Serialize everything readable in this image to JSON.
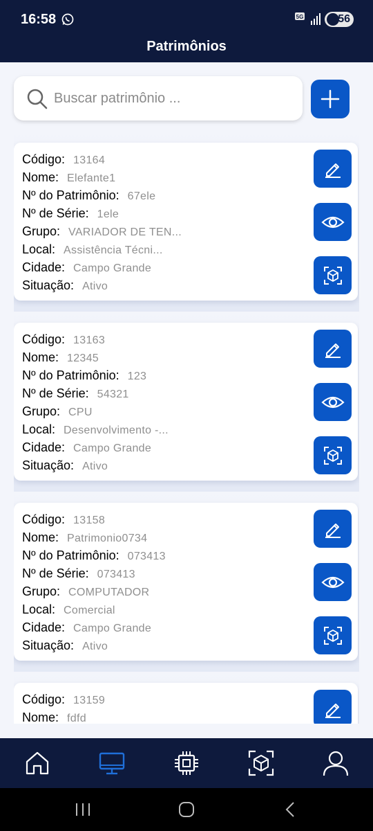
{
  "status_bar": {
    "time": "16:58",
    "network": "5G",
    "battery": "56"
  },
  "header": {
    "title": "Patrimônios"
  },
  "search": {
    "placeholder": "Buscar patrimônio ..."
  },
  "labels": {
    "codigo": "Código:",
    "nome": "Nome:",
    "patrimonio": "Nº do Patrimônio:",
    "serie": "Nº de Série:",
    "grupo": "Grupo:",
    "local": "Local:",
    "cidade": "Cidade:",
    "situacao": "Situação:"
  },
  "items": [
    {
      "codigo": "13164",
      "nome": "Elefante1",
      "patrimonio": "67ele",
      "serie": "1ele",
      "grupo": "VARIADOR DE TEN...",
      "local": "Assistência Técni...",
      "cidade": "Campo Grande",
      "situacao": "Ativo"
    },
    {
      "codigo": "13163",
      "nome": "12345",
      "patrimonio": "123",
      "serie": "54321",
      "grupo": "CPU",
      "local": "Desenvolvimento -...",
      "cidade": "Campo Grande",
      "situacao": "Ativo"
    },
    {
      "codigo": "13158",
      "nome": "Patrimonio0734",
      "patrimonio": "073413",
      "serie": "073413",
      "grupo": "COMPUTADOR",
      "local": "Comercial",
      "cidade": "Campo Grande",
      "situacao": "Ativo"
    },
    {
      "codigo": "13159",
      "nome": "fdfd"
    }
  ],
  "colors": {
    "navy": "#0e1a3d",
    "accent": "#0a57c7",
    "active_nav": "#1f6fd8"
  },
  "icons": {
    "actions": [
      "edit-icon",
      "view-icon",
      "scan-icon"
    ],
    "bottom_nav": [
      "home-icon",
      "monitor-icon",
      "chip-icon",
      "cube-scan-icon",
      "user-icon"
    ],
    "active_nav": "monitor-icon"
  }
}
